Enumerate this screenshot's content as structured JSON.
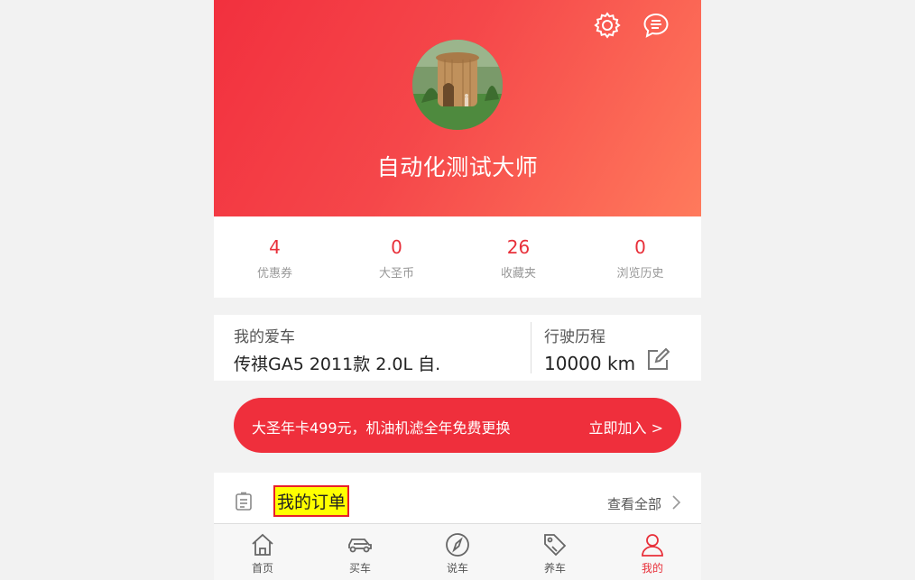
{
  "profile": {
    "username": "自动化测试大师"
  },
  "stats": [
    {
      "value": "4",
      "label": "优惠券"
    },
    {
      "value": "0",
      "label": "大圣币"
    },
    {
      "value": "26",
      "label": "收藏夹"
    },
    {
      "value": "0",
      "label": "浏览历史"
    }
  ],
  "car": {
    "title": "我的爱车",
    "model": "传祺GA5 2011款 2.0L 自.",
    "mileage_title": "行驶历程",
    "mileage": "10000  km"
  },
  "promo": {
    "text": "大圣年卡499元，机油机滤全年免费更换",
    "join": "立即加入 >"
  },
  "orders": {
    "title": "我的订单",
    "view_all": "查看全部"
  },
  "tabs": [
    {
      "label": "首页",
      "icon": "home-icon"
    },
    {
      "label": "买车",
      "icon": "car-icon"
    },
    {
      "label": "说车",
      "icon": "compass-icon"
    },
    {
      "label": "养车",
      "icon": "tag-icon"
    },
    {
      "label": "我的",
      "icon": "user-icon",
      "active": true
    }
  ],
  "colors": {
    "accent": "#e8303a",
    "hero_start": "#f2303e",
    "hero_end": "#ff7a5c"
  }
}
